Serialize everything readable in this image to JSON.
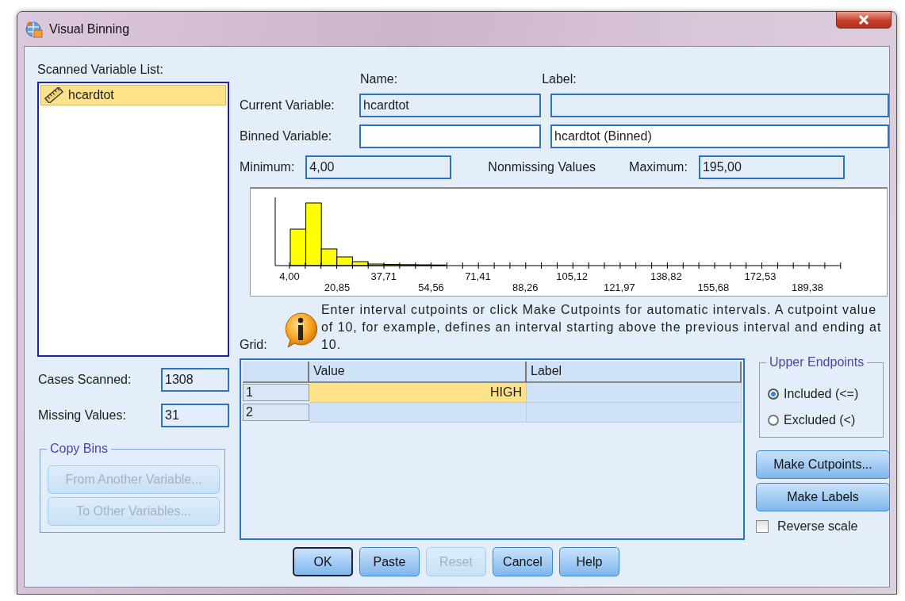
{
  "window": {
    "title": "Visual Binning"
  },
  "scanned_list": {
    "label": "Scanned Variable List:",
    "items": [
      {
        "name": "hcardtot",
        "selected": true
      }
    ]
  },
  "column_headers": {
    "name": "Name:",
    "label": "Label:"
  },
  "current_variable": {
    "label": "Current Variable:",
    "name_value": "hcardtot"
  },
  "binned_variable": {
    "label": "Binned Variable:",
    "label_value": "hcardtot (Binned)"
  },
  "minimum": {
    "label": "Minimum:",
    "value": "4,00"
  },
  "nonmissing": "Nonmissing Values",
  "maximum": {
    "label": "Maximum:",
    "value": "195,00"
  },
  "histogram": {
    "upper_labels": [
      "4,00",
      "37,71",
      "71,41",
      "105,12",
      "138,82",
      "172,53"
    ],
    "lower_labels": [
      "20,85",
      "54,56",
      "88,26",
      "121,97",
      "155,68",
      "189,38"
    ]
  },
  "info_text": "Enter interval cutpoints or click Make Cutpoints for automatic intervals. A cutpoint value of 10, for example, defines an interval starting above the previous interval and ending at 10.",
  "grid": {
    "label": "Grid:",
    "columns": [
      "Value",
      "Label"
    ],
    "rows": [
      {
        "row": "1",
        "value": "HIGH",
        "selected": true
      },
      {
        "row": "2",
        "selected": false
      }
    ]
  },
  "cases_scanned": {
    "label": "Cases Scanned:",
    "value": "1308"
  },
  "missing_values": {
    "label": "Missing Values:",
    "value": "31"
  },
  "copy_bins": {
    "title": "Copy Bins",
    "buttons": [
      {
        "label": "From Another Variable...",
        "disabled": true
      },
      {
        "label": "To Other Variables...",
        "disabled": true
      }
    ]
  },
  "upper_endpoints": {
    "title": "Upper Endpoints",
    "options": [
      {
        "label": "Included (<=)",
        "selected": true
      },
      {
        "label": "Excluded (<)",
        "selected": false
      }
    ]
  },
  "side_buttons": [
    {
      "label": "Make Cutpoints...",
      "disabled": false
    },
    {
      "label": "Make Labels",
      "disabled": false
    }
  ],
  "reverse_scale": {
    "label": "Reverse scale",
    "checked": false
  },
  "footer_buttons": [
    {
      "label": "OK",
      "disabled": false,
      "default": true
    },
    {
      "label": "Paste",
      "disabled": false,
      "default": false
    },
    {
      "label": "Reset",
      "disabled": true,
      "default": false
    },
    {
      "label": "Cancel",
      "disabled": false,
      "default": false
    },
    {
      "label": "Help",
      "disabled": false,
      "default": false
    }
  ]
}
